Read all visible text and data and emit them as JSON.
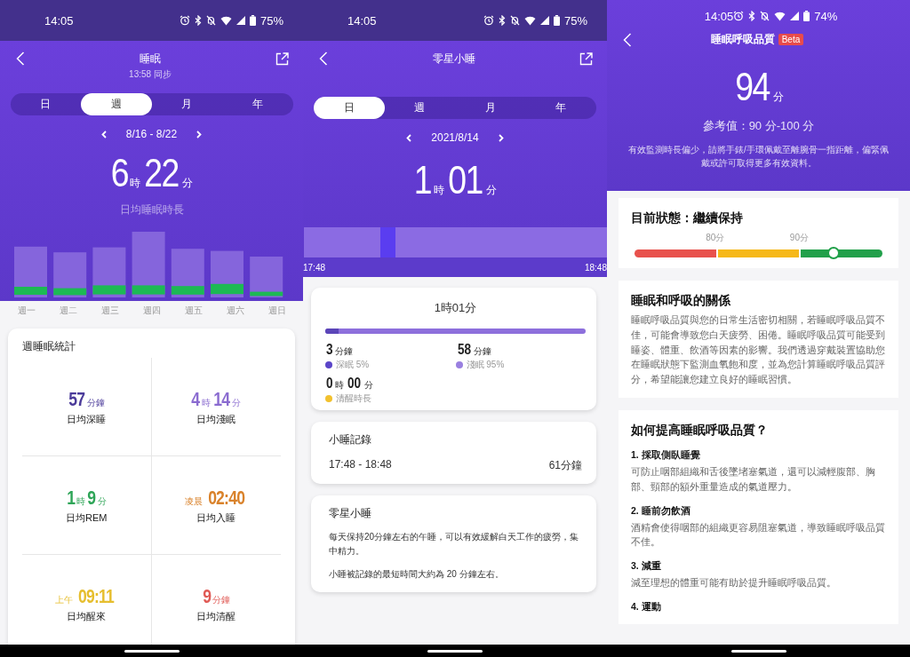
{
  "sleep_screen": {
    "status": {
      "time": "14:05",
      "battery": "75%"
    },
    "title": "睡眠",
    "subtitle": "13:58 同步",
    "tabs": [
      {
        "label": "日",
        "selected": false
      },
      {
        "label": "週",
        "selected": true
      },
      {
        "label": "月",
        "selected": false
      },
      {
        "label": "年",
        "selected": false
      }
    ],
    "range": "8/16 - 8/22",
    "total": [
      {
        "text": "6",
        "kind": "num"
      },
      {
        "text": "時",
        "kind": "unit"
      },
      {
        "text": "22",
        "kind": "num"
      },
      {
        "text": "分",
        "kind": "unit"
      }
    ],
    "total_label": "日均睡眠時長",
    "days": [
      "週一",
      "週二",
      "週三",
      "週四",
      "週五",
      "週六",
      "週日"
    ],
    "stats_title": "週睡眠統計",
    "stats": [
      {
        "value": [
          {
            "text": "57",
            "kind": "num"
          },
          {
            "text": "分鐘",
            "kind": "unit"
          }
        ],
        "label": "日均深睡",
        "color": "#4b3b9a"
      },
      {
        "value": [
          {
            "text": "4",
            "kind": "num"
          },
          {
            "text": "時",
            "kind": "unit"
          },
          {
            "text": "14",
            "kind": "num"
          },
          {
            "text": "分",
            "kind": "unit"
          }
        ],
        "label": "日均淺眠",
        "color": "#8a6bd0"
      },
      {
        "value": [
          {
            "text": "1",
            "kind": "num"
          },
          {
            "text": "時",
            "kind": "unit"
          },
          {
            "text": "9",
            "kind": "num"
          },
          {
            "text": "分",
            "kind": "unit"
          }
        ],
        "label": "日均REM",
        "color": "#2ea557"
      },
      {
        "value": [
          {
            "text": "凌晨",
            "kind": "unit"
          },
          {
            "text": "02:40",
            "kind": "num"
          }
        ],
        "label": "日均入睡",
        "color": "#d9822b"
      },
      {
        "value": [
          {
            "text": "上午",
            "kind": "unit"
          },
          {
            "text": "09:11",
            "kind": "num"
          }
        ],
        "label": "日均醒來",
        "color": "#e6be2e"
      },
      {
        "value": [
          {
            "text": "9",
            "kind": "num"
          },
          {
            "text": "分鐘",
            "kind": "unit"
          }
        ],
        "label": "日均清醒",
        "color": "#e05a55"
      }
    ]
  },
  "nap_screen": {
    "status": {
      "time": "14:05",
      "battery": "75%"
    },
    "title": "零星小睡",
    "tabs": [
      {
        "label": "日",
        "selected": true
      },
      {
        "label": "週",
        "selected": false
      },
      {
        "label": "月",
        "selected": false
      },
      {
        "label": "年",
        "selected": false
      }
    ],
    "date": "2021/8/14",
    "total": [
      {
        "text": "1",
        "kind": "num"
      },
      {
        "text": "時",
        "kind": "unit"
      },
      {
        "text": "01",
        "kind": "num"
      },
      {
        "text": "分",
        "kind": "unit"
      }
    ],
    "timeline_start": "17:48",
    "timeline_end": "18:48",
    "summary": {
      "total": "1時01分",
      "level": 0.05,
      "stages": [
        {
          "value": [
            {
              "text": "3",
              "kind": "num"
            },
            {
              "text": "分鐘",
              "kind": "unit"
            }
          ],
          "label": "深眠 5%",
          "color": "#5b45c8"
        },
        {
          "value": [
            {
              "text": "58",
              "kind": "num"
            },
            {
              "text": "分鐘",
              "kind": "unit"
            }
          ],
          "label": "淺眠 95%",
          "color": "#9a80e0"
        },
        {
          "value": [
            {
              "text": "0",
              "kind": "num"
            },
            {
              "text": "時",
              "kind": "unit"
            },
            {
              "text": "00",
              "kind": "num"
            },
            {
              "text": "分",
              "kind": "unit"
            }
          ],
          "label": "清醒時長",
          "color": "#f2c12e"
        }
      ]
    },
    "record": {
      "title": "小睡記錄",
      "range": "17:48 - 18:48",
      "duration": "61分鐘"
    },
    "info": {
      "title": "零星小睡",
      "paragraphs": [
        "每天保持20分鐘左右的午睡，可以有效緩解白天工作的疲勞，集中精力。",
        "小睡被記錄的最短時間大約為 20 分鐘左右。"
      ]
    }
  },
  "breathing_screen": {
    "status": {
      "time": "14:05",
      "battery": "74%"
    },
    "title": "睡眠呼吸品質",
    "badge": "Beta",
    "score": [
      {
        "text": "94",
        "kind": "num"
      },
      {
        "text": "分",
        "kind": "unit"
      }
    ],
    "reference": "參考值：90 分-100 分",
    "notice": "有效監測時長偏少，請將手錶/手環佩戴至離腕骨一指距離，偏緊佩戴或許可取得更多有效資料。",
    "status_card": {
      "title": "目前狀態：繼續保持",
      "marks": [
        "80分",
        "90分"
      ],
      "level": 0.79
    },
    "relation": {
      "title": "睡眠和呼吸的關係",
      "body": "睡眠呼吸品質與您的日常生活密切相關，若睡眠呼吸品質不佳，可能會導致您白天疲勞、困倦。睡眠呼吸品質可能受到睡姿、體重、飲酒等因素的影響。我們透過穿戴裝置協助您在睡眠狀態下監測血氧飽和度，並為您計算睡眠呼吸品質評分，希望能讓您建立良好的睡眠習慣。"
    },
    "tips": {
      "title": "如何提高睡眠呼吸品質？",
      "items": [
        {
          "title": "1. 採取側臥睡覺",
          "body": "可防止咽部組織和舌後墜堵塞氣道，還可以減輕腹部、胸部、頸部的額外重量造成的氣道壓力。"
        },
        {
          "title": "2. 睡前勿飲酒",
          "body": "酒精會使得咽部的組織更容易阻塞氣道，導致睡眠呼吸品質不佳。"
        },
        {
          "title": "3. 減重",
          "body": "減至理想的體重可能有助於提升睡眠呼吸品質。"
        },
        {
          "title": "4. 運動"
        }
      ]
    }
  }
}
